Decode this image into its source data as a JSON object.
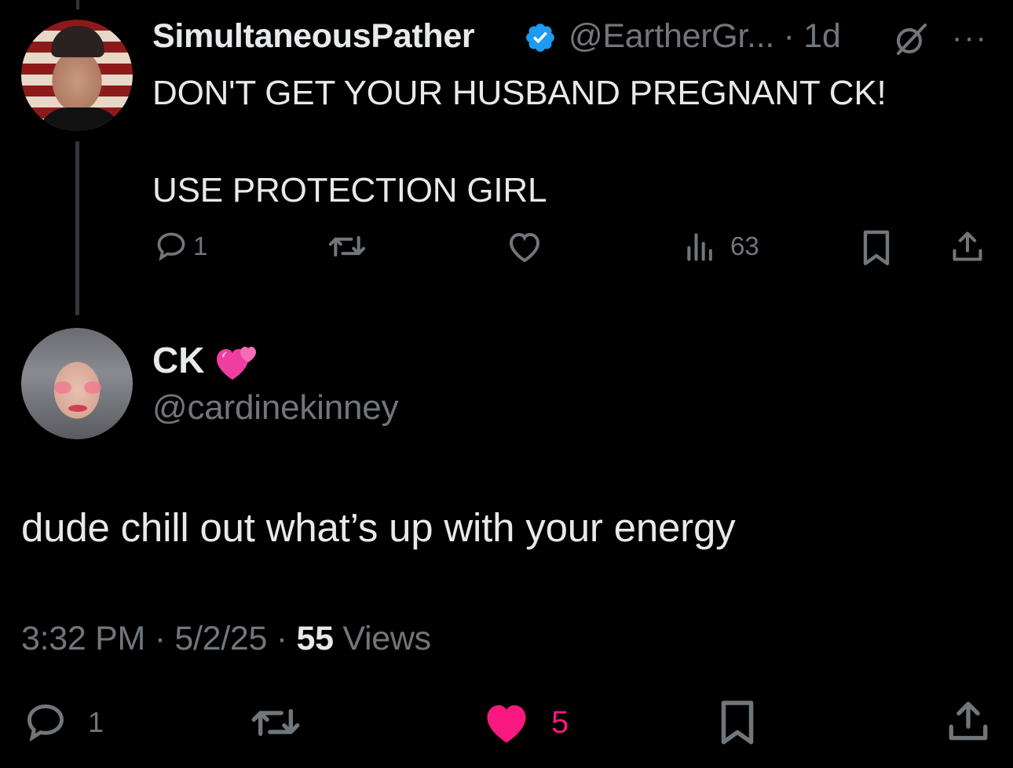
{
  "parent_tweet": {
    "display_name": "SimultaneousPather",
    "handle_time": "@EartherGr... · 1d",
    "more": "···",
    "text": "DON'T GET YOUR HUSBAND PREGNANT CK!\n\nUSE PROTECTION GIRL",
    "actions": {
      "reply_count": "1",
      "views_count": "63"
    }
  },
  "main_tweet": {
    "display_name": "CK",
    "emoji": "two-hearts",
    "handle": "@cardinekinney",
    "text": "dude chill out what’s up with your energy",
    "time": "3:32 PM",
    "date": "5/2/25",
    "views_count": "55",
    "views_label": "Views",
    "actions": {
      "reply_count": "1",
      "like_count": "5"
    }
  },
  "colors": {
    "background": "#000000",
    "text": "#e7e9ea",
    "muted": "#71767b",
    "verified": "#1d9bf0",
    "like_active": "#f91880"
  }
}
